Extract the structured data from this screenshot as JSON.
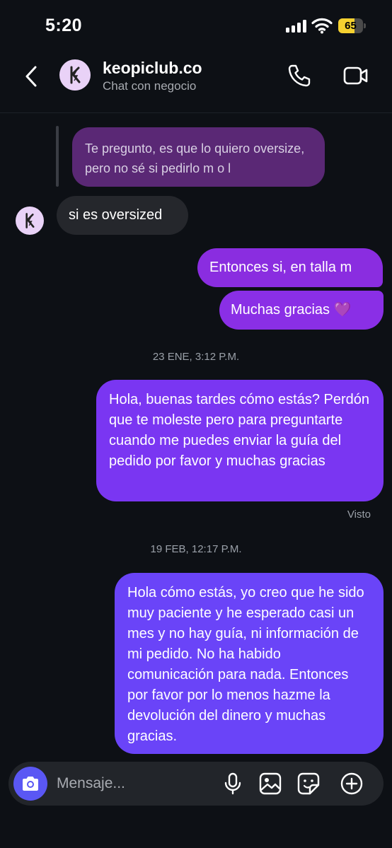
{
  "status_bar": {
    "time": "5:20",
    "battery_level": "65",
    "battery_color": "#f5d130"
  },
  "header": {
    "contact_name": "keopiclub.co",
    "contact_subtitle": "Chat con negocio",
    "icons": [
      "back-icon",
      "phone-icon",
      "video-camera-icon"
    ]
  },
  "messages": {
    "reply_preview": "Te pregunto, es que lo quiero oversize, pero no sé si pedirlo m o l",
    "received_1": "si es oversized",
    "sent_1": "Entonces si, en talla m",
    "sent_2": "Muchas gracias 💜",
    "timestamp_1": "23 ENE, 3:12 P.M.",
    "sent_3": "Hola, buenas tardes cómo estás? Perdón que te moleste pero para preguntarte cuando me puedes enviar la guía del pedido por favor y muchas gracias",
    "seen_label": "Visto",
    "timestamp_2": "19 FEB, 12:17 P.M.",
    "sent_4": "Hola cómo estás, yo creo que he sido muy paciente y he esperado casi un mes y no hay guía, ni información de mi pedido. No ha habido comunicación para nada. Entonces por favor por lo menos hazme la devolución del dinero y muchas gracias."
  },
  "composer": {
    "placeholder": "Mensaje...",
    "icons": [
      "camera-icon",
      "microphone-icon",
      "gallery-icon",
      "sticker-icon",
      "plus-icon"
    ]
  },
  "colors": {
    "background": "#0d1015",
    "received_bubble": "#25272c",
    "sent_bubble_top": "#8a2de0",
    "sent_bubble_bottom": "#6a44f8",
    "reply_bubble": "#5a2875",
    "camera_button": "#5a57f4"
  }
}
